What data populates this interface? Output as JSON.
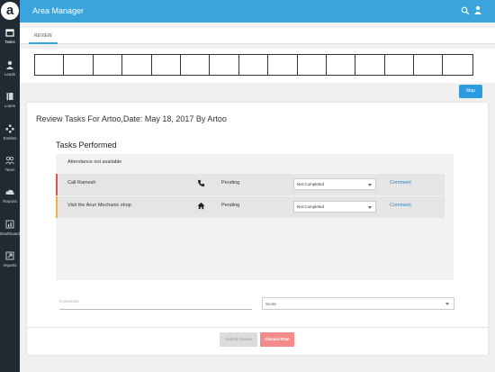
{
  "app": {
    "logo": "a",
    "title": "Area Manager"
  },
  "sidebar": {
    "items": [
      {
        "label": "Tasks",
        "icon": "calendar-icon"
      },
      {
        "label": "Leads",
        "icon": "person-icon"
      },
      {
        "label": "Loans",
        "icon": "book-icon"
      },
      {
        "label": "Entities",
        "icon": "entities-icon"
      },
      {
        "label": "Team",
        "icon": "team-icon"
      },
      {
        "label": "Reports",
        "icon": "cloud-icon"
      },
      {
        "label": "Dashboard",
        "icon": "dashboard-icon"
      },
      {
        "label": "Imports",
        "icon": "import-icon"
      }
    ]
  },
  "tabs": {
    "review": "REVIEW"
  },
  "map_button": "Map",
  "review": {
    "title": "Review Tasks For Artoo,Date: May 18, 2017 By Artoo",
    "tasks_performed_title": "Tasks Performed",
    "attendance": "Attendance not available",
    "tasks": [
      {
        "name": "Call Ramesh",
        "icon": "phone-icon",
        "status": "Pending",
        "select_value": "Not Completed",
        "comment": "Comment",
        "accent": "#d9534f"
      },
      {
        "name": "Visit the Arun Mechanic shop",
        "icon": "home-icon",
        "status": "Pending",
        "select_value": "Not Completed",
        "comment": "Comment",
        "accent": "#f0ad4e"
      }
    ],
    "comments_placeholder": "Comments",
    "score_placeholder": "Score",
    "submit_label": "Submit Review",
    "discard_label": "Discard Plan"
  },
  "colors": {
    "header": "#3aa4dc",
    "sidebar": "#1f2a33",
    "map_button": "#2d9be0",
    "discard_button": "#f48a8a"
  }
}
